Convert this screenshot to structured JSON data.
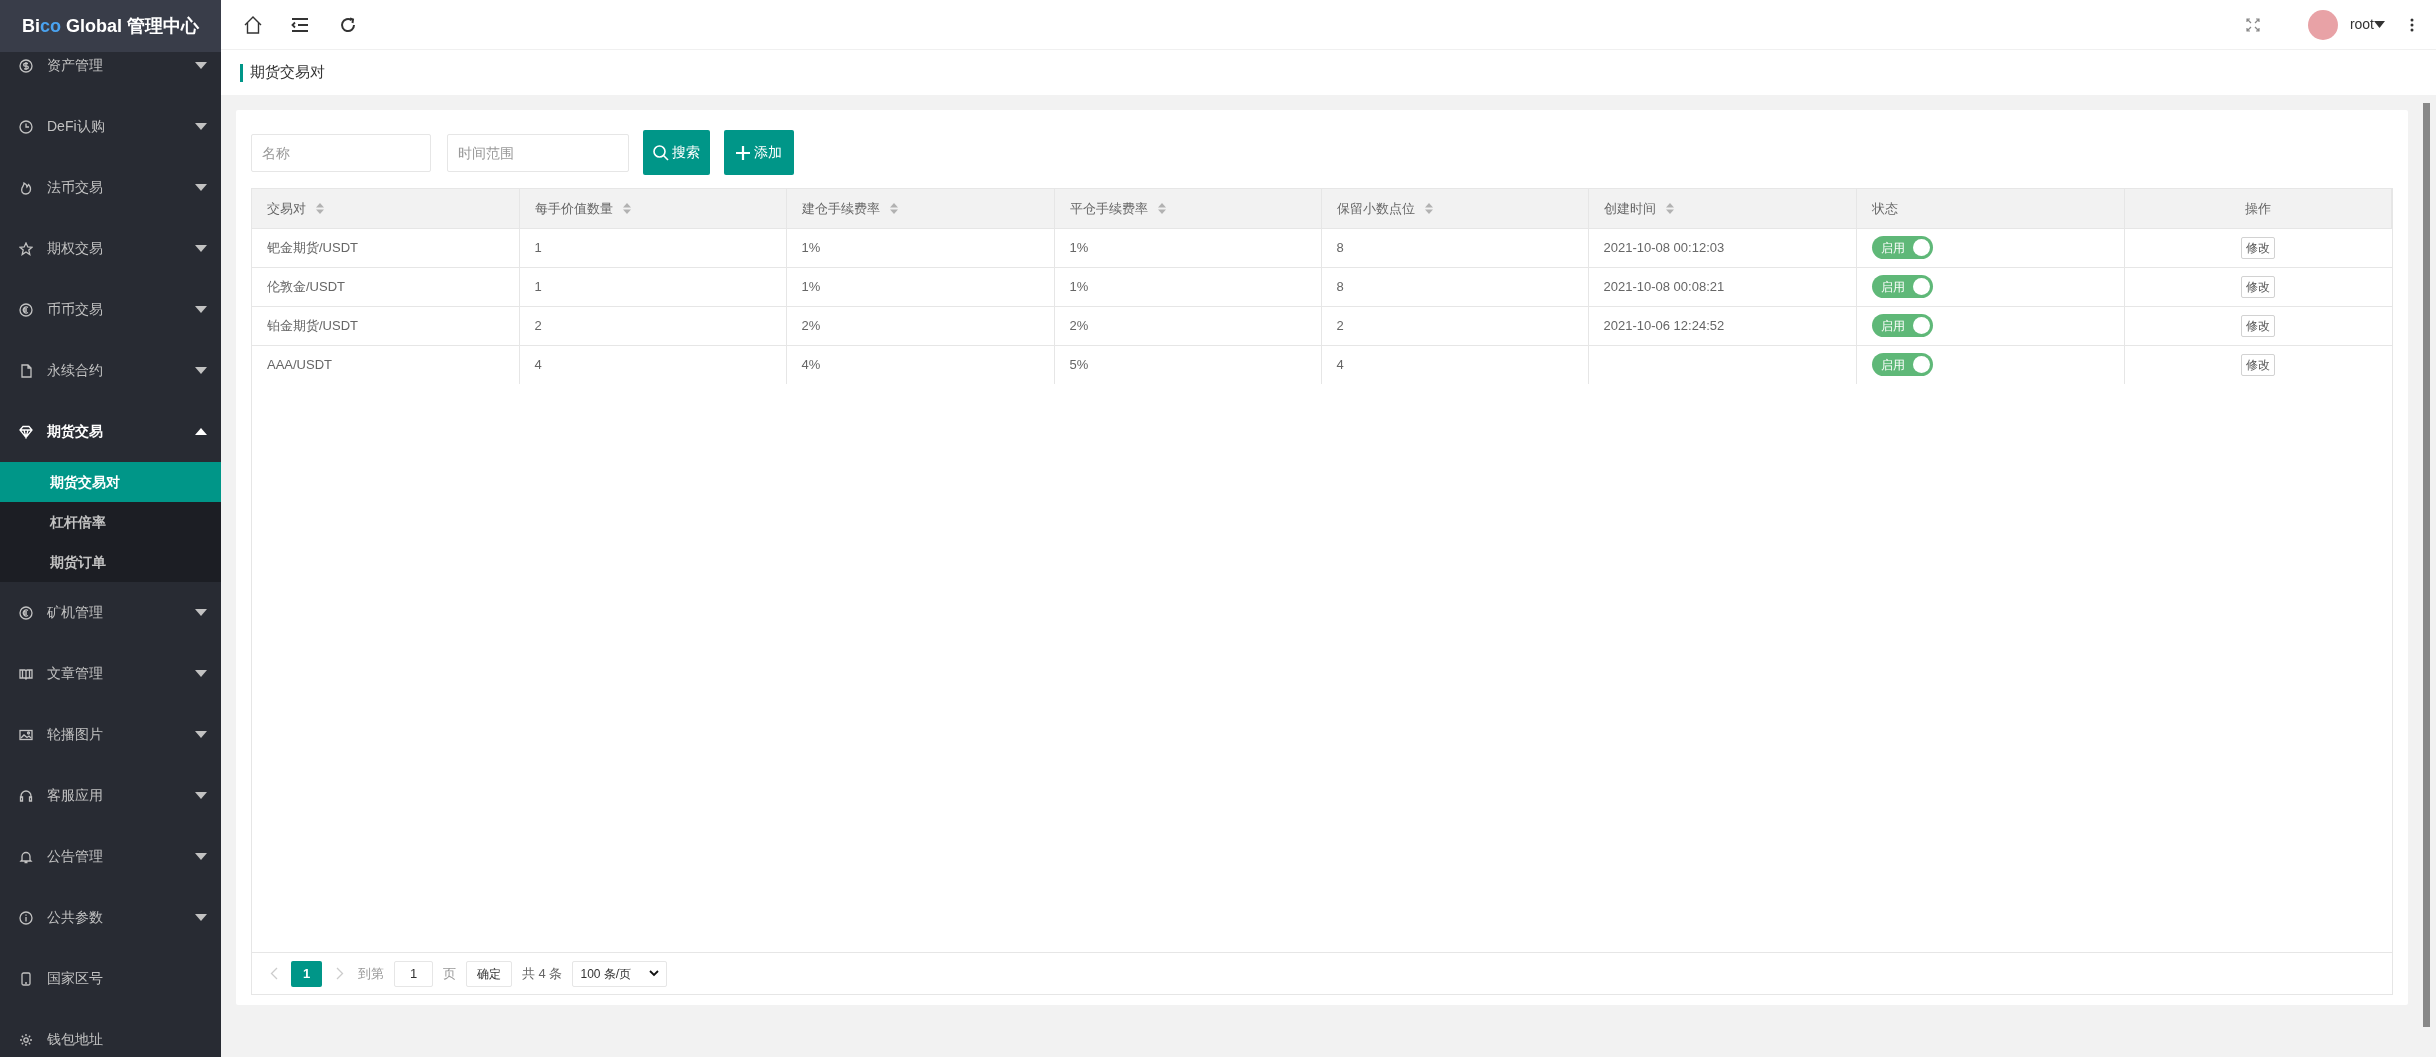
{
  "brand": {
    "prefix": "Bi",
    "accent": "co",
    "rest": " Global 管理中心"
  },
  "sidebar": {
    "items": [
      {
        "label": "资产管理",
        "kind": "group",
        "expanded": false
      },
      {
        "label": "DeFi认购",
        "kind": "group",
        "expanded": false
      },
      {
        "label": "法币交易",
        "kind": "group",
        "expanded": false
      },
      {
        "label": "期权交易",
        "kind": "group",
        "expanded": false
      },
      {
        "label": "币币交易",
        "kind": "group",
        "expanded": false
      },
      {
        "label": "永续合约",
        "kind": "group",
        "expanded": false
      },
      {
        "label": "期货交易",
        "kind": "group",
        "expanded": true,
        "children": [
          {
            "label": "期货交易对",
            "selected": true
          },
          {
            "label": "杠杆倍率",
            "selected": false
          },
          {
            "label": "期货订单",
            "selected": false
          }
        ]
      },
      {
        "label": "矿机管理",
        "kind": "group",
        "expanded": false
      },
      {
        "label": "文章管理",
        "kind": "group",
        "expanded": false
      },
      {
        "label": "轮播图片",
        "kind": "group",
        "expanded": false
      },
      {
        "label": "客服应用",
        "kind": "group",
        "expanded": false
      },
      {
        "label": "公告管理",
        "kind": "group",
        "expanded": false
      },
      {
        "label": "公共参数",
        "kind": "group",
        "expanded": false
      },
      {
        "label": "国家区号",
        "kind": "link"
      },
      {
        "label": "钱包地址",
        "kind": "link"
      }
    ]
  },
  "topbar": {
    "user": "root"
  },
  "breadcrumb": "期货交易对",
  "filters": {
    "name_placeholder": "名称",
    "time_placeholder": "时间范围",
    "search": "搜索",
    "add": "添加"
  },
  "table": {
    "columns": [
      {
        "label": "交易对",
        "sortable": true
      },
      {
        "label": "每手价值数量",
        "sortable": true
      },
      {
        "label": "建仓手续费率",
        "sortable": true
      },
      {
        "label": "平仓手续费率",
        "sortable": true
      },
      {
        "label": "保留小数点位",
        "sortable": true
      },
      {
        "label": "创建时间",
        "sortable": true
      },
      {
        "label": "状态",
        "sortable": false
      },
      {
        "label": "操作",
        "sortable": false
      }
    ],
    "rows": [
      {
        "cells": [
          "钯金期货/USDT",
          "1",
          "1%",
          "1%",
          "8",
          "2021-10-08 00:12:03"
        ],
        "status": {
          "label": "启用",
          "on": true
        },
        "action": "修改"
      },
      {
        "cells": [
          "伦敦金/USDT",
          "1",
          "1%",
          "1%",
          "8",
          "2021-10-08 00:08:21"
        ],
        "status": {
          "label": "启用",
          "on": true
        },
        "action": "修改"
      },
      {
        "cells": [
          "铂金期货/USDT",
          "2",
          "2%",
          "2%",
          "2",
          "2021-10-06 12:24:52"
        ],
        "status": {
          "label": "启用",
          "on": true
        },
        "action": "修改"
      },
      {
        "cells": [
          "AAA/USDT",
          "4",
          "4%",
          "5%",
          "4"
        ],
        "status": {
          "label": "启用",
          "on": true
        },
        "action": "修改"
      }
    ]
  },
  "pagination": {
    "pages": [
      {
        "label": "1",
        "selected": true
      }
    ],
    "goto_label": "到第",
    "goto_value": "1",
    "page_unit": "页",
    "confirm": "确定",
    "total": "共 4 条",
    "page_size": "100 条/页"
  }
}
